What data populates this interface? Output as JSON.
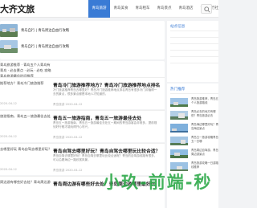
{
  "site": {
    "logo": "大齐文旅"
  },
  "nav": {
    "items": [
      {
        "label": "青岛旅游",
        "active": true
      },
      {
        "label": "青岛美食"
      },
      {
        "label": "青岛租车"
      },
      {
        "label": "青岛景点"
      },
      {
        "label": "青岛酒店"
      },
      {
        "label": "青岛旅行社"
      }
    ]
  },
  "featured": {
    "slides": [
      {
        "title": "青岛自行 | 青岛周边自由行攻略"
      },
      {
        "title": "青岛自行 | 青岛周边自由行攻略"
      }
    ],
    "side_rows": [
      {
        "text": "青岛旅游推荐 · 青岛五个人青岛有"
      },
      {
        "text": "青岛 · 必去景点 · 必玩 · 必吃 攻略"
      },
      {
        "text": "青岛旅游最佳时间推荐"
      }
    ]
  },
  "articles": [
    {
      "title": "青岛冷门旅游推荐地方？青岛冷门旅游推荐地点排名",
      "desc": "冷门旅游推荐青岛去哪里好？青岛冷门旅游推荐地点排名青岛有很多冷门却值得一去的景点，很多景点都是本地人才知道的，",
      "meta": "青岛旅游    2020-04-12",
      "left": "推荐地方？青岛冷门旅游推荐",
      "leftmeta": "2020-04-12"
    },
    {
      "title": "青岛五一旅游指南，青岛五一旅游最佳去处",
      "desc": "青岛五一旅游指南，青岛五一旅游最佳去处五一期间的青岛游客会非常多，提前规划好行程才能玩得开心尽兴，",
      "meta": "青岛旅游    2020-04-12",
      "left": "旅游指南，青岛五一旅游最佳去处",
      "leftmeta": "2020-04-12"
    },
    {
      "title": "青岛自驾去哪里好玩？青岛自驾去哪里玩比较合适？",
      "desc": "青岛自驾去哪里好玩？青岛自驾去哪里玩比较合适呢？青岛的自驾游线路有很多，可以沿着海边一路欣赏风景，",
      "meta": "青岛旅游    2020-04-12",
      "left": "去哪里好玩 青岛自驾去哪里好玩？",
      "leftmeta": "2020-04-12"
    },
    {
      "title": "青岛周边游有哪些好去处？青岛周边游哪里最好玩",
      "desc": "",
      "meta": "",
      "left": "周边游有哪些好去处？青岛周边游",
      "leftmeta": ""
    }
  ],
  "sidebar": {
    "notice_title": "站点信息",
    "recommend_title": "热门推荐",
    "rec_items": [
      {
        "text": "青岛旅游推荐，青岛五个人旅游路线"
      },
      {
        "text": "青岛必去的地方有哪些？青岛旅游必去"
      },
      {
        "text": "青岛海边哪里好玩？青岛海边景点"
      },
      {
        "text": "青岛五一旅游攻略青岛五一去哪"
      },
      {
        "text": "青岛周边自驾游，青岛周边游景点"
      },
      {
        "text": "青岛旅游攻略一日游路线推荐"
      }
    ]
  },
  "watermark": "小玖-前端-秒"
}
